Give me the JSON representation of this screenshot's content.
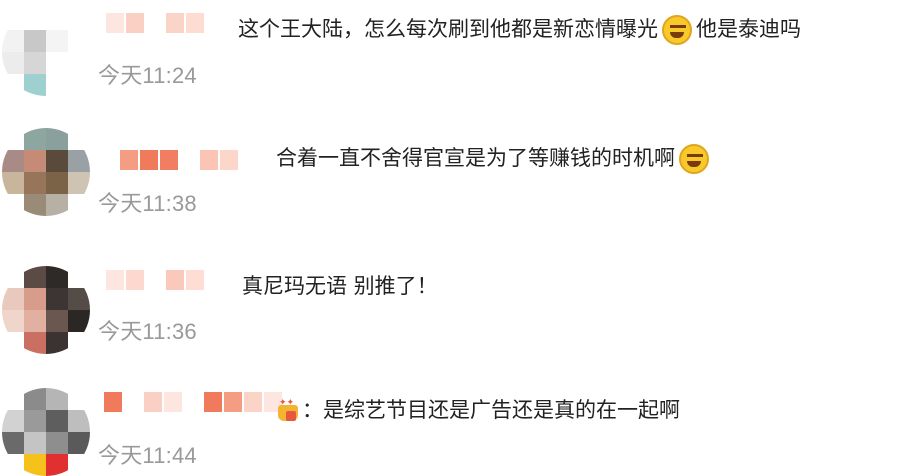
{
  "comments": [
    {
      "timestamp": "今天11:24",
      "text": "这个王大陆，怎么每次刷到他都是新恋情曝光",
      "text_after_emoji": "他是泰迪吗",
      "emoji": "sweat-smile-emoji",
      "avatar_colors": [
        "#ffffff",
        "#ffffff",
        "#ffffff",
        "#ffffff",
        "#f2f2f2",
        "#c8c8c8",
        "#f4f4f4",
        "#ffffff",
        "#ececec",
        "#d6d6d6",
        "#ffffff",
        "#ffffff",
        "#ffffff",
        "#9fd0d0",
        "#ffffff",
        "#ffffff"
      ],
      "name_colors": [
        "#fde6e0",
        "#fbd0c4",
        "#ffffff",
        "#fbd4c8",
        "#fddcd2"
      ]
    },
    {
      "timestamp": "今天11:38",
      "text": "合着一直不舍得官宣是为了等赚钱的时机啊",
      "text_after_emoji": "",
      "emoji": "laugh-tears-emoji",
      "avatar_colors": [
        "#ffffff",
        "#8da6a0",
        "#8aa09c",
        "#ffffff",
        "#a88b86",
        "#c68b77",
        "#5a4a3c",
        "#9aa1a4",
        "#c8b59c",
        "#96755a",
        "#7b6348",
        "#cfc3b4",
        "#ffffff",
        "#9a8b78",
        "#b7b0a5",
        "#ffffff"
      ],
      "name_colors": [
        "#f59d83",
        "#f07b5c",
        "#f27e62",
        "#ffffff",
        "#fbc4b4",
        "#fdd6cb"
      ]
    },
    {
      "timestamp": "今天11:36",
      "text": "真尼玛无语 别推了！",
      "text_after_emoji": "",
      "emoji": "",
      "avatar_colors": [
        "#ffffff",
        "#5c4a45",
        "#2e2a28",
        "#ffffff",
        "#e9c8bd",
        "#d79c8a",
        "#3d3533",
        "#554b47",
        "#f0d5cb",
        "#e2b0a0",
        "#6a5750",
        "#2b2725",
        "#ffffff",
        "#c97063",
        "#3a3331",
        "#ffffff"
      ],
      "name_colors": [
        "#fde6e0",
        "#fdd8ce",
        "#ffffff",
        "#fbc9bc",
        "#fdddd4"
      ]
    },
    {
      "timestamp": "今天11:44",
      "text": "：是综艺节目还是广告还是真的在一起啊",
      "text_after_emoji": "",
      "emoji": "trophy-badge-icon",
      "avatar_colors": [
        "#ffffff",
        "#8b8b8b",
        "#b5b5b5",
        "#ffffff",
        "#d2d2d2",
        "#9a9a9a",
        "#5e5e5e",
        "#bebebe",
        "#6a6a6a",
        "#c4c4c4",
        "#8e8e8e",
        "#5a5a5a",
        "#ffffff",
        "#f4c21a",
        "#e13030",
        "#ffffff"
      ],
      "name_colors": [
        "#f07b5c",
        "#ffffff",
        "#fbd0c4",
        "#fde6e0",
        "#ffffff",
        "#f07b5c",
        "#f59d83",
        "#fbd4c8",
        "#fde6e0"
      ]
    }
  ]
}
